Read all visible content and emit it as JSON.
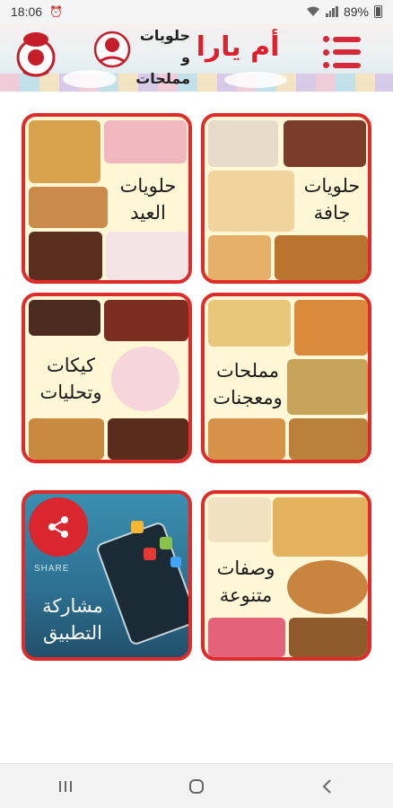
{
  "status_bar": {
    "time": "18:06",
    "battery": "89%"
  },
  "header": {
    "brand_title": "أم يارا",
    "subtitle_line1": "حلويات",
    "subtitle_line2": "و مملحات",
    "accent_color": "#e01e2c"
  },
  "categories": [
    {
      "label": "حلويات\nجافة"
    },
    {
      "label": "حلويات\nالعيد"
    },
    {
      "label": "مملحات\nومعجنات"
    },
    {
      "label": "كيكات\nوتحليات"
    },
    {
      "label": "وصفات\nمتنوعة"
    },
    {
      "label": "مشاركة\nالتطبيق",
      "share_caption": "SHARE"
    }
  ],
  "card_border_color": "#e02b2b",
  "icons": [
    "menu-icon",
    "share-icon",
    "back-icon",
    "home-icon",
    "recents-icon"
  ]
}
